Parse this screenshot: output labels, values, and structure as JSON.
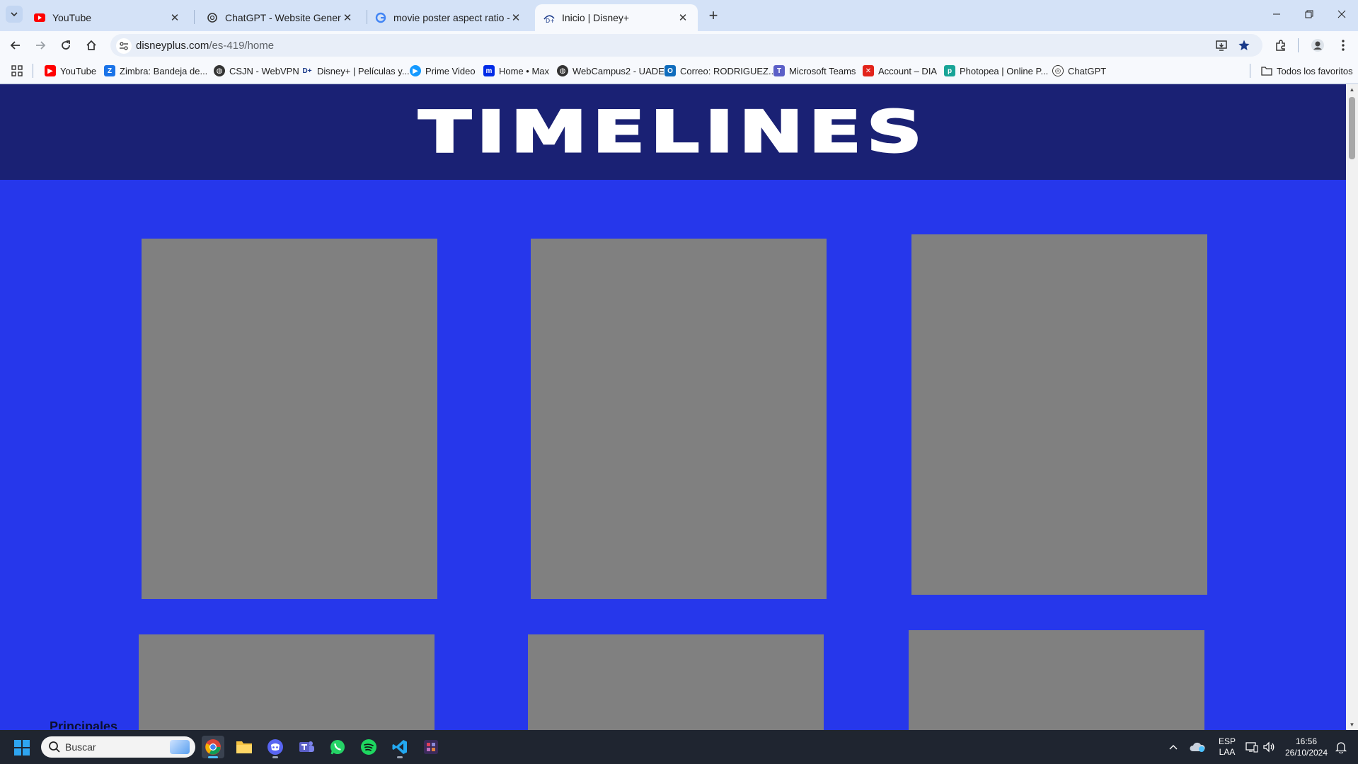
{
  "browser": {
    "tabs": [
      {
        "title": "YouTube",
        "icon": "youtube-icon",
        "active": false
      },
      {
        "title": "ChatGPT - Website Generator",
        "icon": "chatgpt-icon",
        "active": false
      },
      {
        "title": "movie poster aspect ratio - Bus",
        "icon": "google-icon",
        "active": false
      },
      {
        "title": "Inicio | Disney+",
        "icon": "disney-plus-icon",
        "active": true
      }
    ],
    "address_bar": {
      "domain": "disneyplus.com",
      "path": "/es-419/home"
    },
    "bookmarks": [
      {
        "label": "YouTube",
        "icon": "youtube-icon",
        "color": "#ff0000"
      },
      {
        "label": "Zimbra: Bandeja de...",
        "icon": "zimbra-icon",
        "color": "#1a73e8"
      },
      {
        "label": "CSJN - WebVPN",
        "icon": "globe-icon",
        "color": "#333333"
      },
      {
        "label": "Disney+ | Películas y...",
        "icon": "disney-plus-icon",
        "color": "#1a3a8a"
      },
      {
        "label": "Prime Video",
        "icon": "prime-video-icon",
        "color": "#1399ff"
      },
      {
        "label": "Home • Max",
        "icon": "max-icon",
        "color": "#002be7"
      },
      {
        "label": "WebCampus2 - UADE",
        "icon": "globe-icon",
        "color": "#333333"
      },
      {
        "label": "Correo: RODRIGUEZ...",
        "icon": "outlook-icon",
        "color": "#0f6cbd"
      },
      {
        "label": "Microsoft Teams",
        "icon": "teams-icon",
        "color": "#5b5fc7"
      },
      {
        "label": "Account – DIA",
        "icon": "dia-icon",
        "color": "#e2231a"
      },
      {
        "label": "Photopea | Online P...",
        "icon": "photopea-icon",
        "color": "#18a497"
      },
      {
        "label": "ChatGPT",
        "icon": "chatgpt-icon",
        "color": "#333333"
      }
    ],
    "all_bookmarks_label": "Todos los favoritos"
  },
  "page": {
    "title": "TIMELINES",
    "header_color": "#1a2174",
    "background_color": "#2637eb",
    "poster_color": "#808080",
    "peek_text": "Principales"
  },
  "taskbar": {
    "search_placeholder": "Buscar",
    "apps": [
      "chrome-icon",
      "file-explorer-icon",
      "discord-icon",
      "teams-icon",
      "whatsapp-icon",
      "spotify-icon",
      "vscode-icon",
      "game-icon"
    ],
    "language": {
      "line1": "ESP",
      "line2": "LAA"
    },
    "time": "16:56",
    "date": "26/10/2024"
  }
}
